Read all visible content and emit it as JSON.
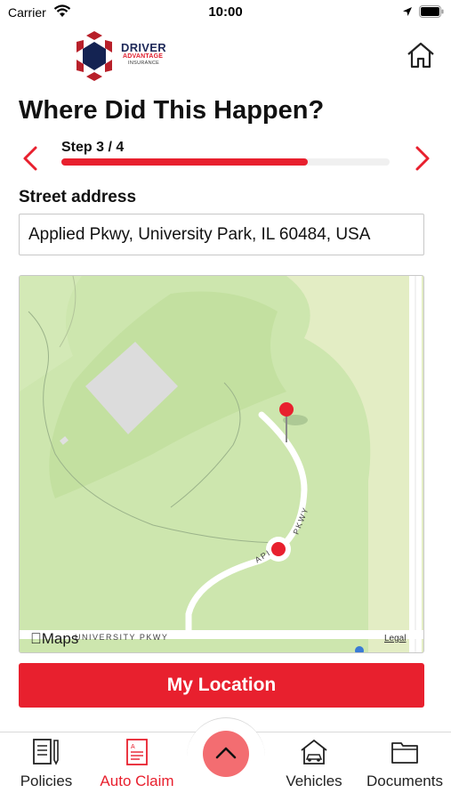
{
  "status_bar": {
    "carrier": "Carrier",
    "time": "10:00"
  },
  "header": {
    "logo_main": "DRIVER",
    "logo_sub": "ADVANTAGE",
    "logo_sub2": "INSURANCE",
    "home_icon": "home-icon"
  },
  "page": {
    "title": "Where Did This Happen?"
  },
  "stepper": {
    "label": "Step 3 / 4",
    "progress": 0.75
  },
  "address": {
    "label": "Street address",
    "value": "Applied Pkwy, University Park, IL 60484, USA"
  },
  "map": {
    "attribution": "Maps",
    "legal": "Legal",
    "streets": [
      "PKWY",
      "API",
      "UNIVERSITY PKWY"
    ]
  },
  "actions": {
    "my_location": "My Location"
  },
  "tabs": [
    {
      "label": "Policies",
      "icon": "document-pen-icon",
      "active": false
    },
    {
      "label": "Auto Claim",
      "icon": "claim-form-icon",
      "active": true
    },
    {
      "label": "Vehicles",
      "icon": "house-car-icon",
      "active": false
    },
    {
      "label": "Documents",
      "icon": "folder-icon",
      "active": false
    }
  ],
  "colors": {
    "accent": "#e8202e",
    "fab": "#f36d71",
    "brand_navy": "#1f2a5a",
    "map_land": "#d6e7b8"
  }
}
